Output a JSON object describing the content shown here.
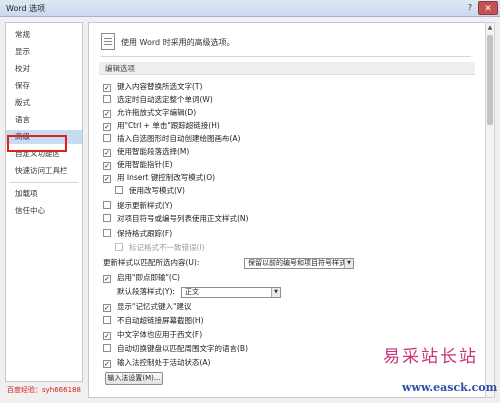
{
  "window": {
    "title": "Word 选项",
    "help_glyph": "?",
    "close_glyph": "✕"
  },
  "sidebar": {
    "items": [
      {
        "label": "常规"
      },
      {
        "label": "显示"
      },
      {
        "label": "校对"
      },
      {
        "label": "保存"
      },
      {
        "label": "版式"
      },
      {
        "label": "语言"
      },
      {
        "label": "高级"
      },
      {
        "label": "自定义功能区"
      },
      {
        "label": "快速访问工具栏"
      },
      {
        "label": "加载项"
      },
      {
        "label": "信任中心"
      }
    ],
    "selected_index": 6
  },
  "main": {
    "header_text": "使用 Word 时采用的高级选项。",
    "section_title": "编辑选项",
    "options": [
      {
        "label": "键入内容替换所选文字(T)",
        "checked": true
      },
      {
        "label": "选定时自动选定整个单词(W)",
        "checked": false
      },
      {
        "label": "允许拖放式文字编辑(D)",
        "checked": true
      },
      {
        "label": "用\"Ctrl + 单击\"跟踪超链接(H)",
        "checked": true
      },
      {
        "label": "插入自选图形时自动创建绘图画布(A)",
        "checked": false
      },
      {
        "label": "使用智能段落选择(M)",
        "checked": true
      },
      {
        "label": "使用智能指针(E)",
        "checked": true
      },
      {
        "label": "用 Insert 键控制改写模式(O)",
        "checked": true
      },
      {
        "label": "使用改写模式(V)",
        "checked": false
      },
      {
        "label": "提示更新样式(Y)",
        "checked": false
      },
      {
        "label": "对项目符号或编号列表使用正文样式(N)",
        "checked": false
      },
      {
        "label": "保持格式跟踪(F)",
        "checked": false
      },
      {
        "label": "标记格式不一致错误(I)",
        "checked": false,
        "disabled": true
      }
    ],
    "paste_style_label": "更新样式以匹配所选内容(U):",
    "paste_style_value": "保留以前的编号和项目符号样式",
    "options2": [
      {
        "label": "启用\"即点即输\"(C)",
        "checked": true
      }
    ],
    "default_para_label": "默认段落样式(Y):",
    "default_para_value": "正文",
    "options3": [
      {
        "label": "显示\"记忆式键入\"建议",
        "checked": true
      },
      {
        "label": "不自动超链接屏幕截图(H)",
        "checked": false
      },
      {
        "label": "中文字体也应用于西文(F)",
        "checked": true
      },
      {
        "label": "自动切换键盘以匹配周围文字的语言(B)",
        "checked": false
      },
      {
        "label": "输入法控制处于活动状态(A)",
        "checked": true
      }
    ],
    "ime_button": "输入法设置(M)..."
  },
  "footer": {
    "credit": "百度经验：syh666188"
  },
  "watermark": {
    "line1": "易采站长站",
    "line2": "www.easck.com"
  },
  "colors": {
    "selection": "#c7dcf3",
    "highlight_border": "#e02020",
    "watermark_pink": "#cf2f79",
    "watermark_blue": "#2f4fa5"
  }
}
